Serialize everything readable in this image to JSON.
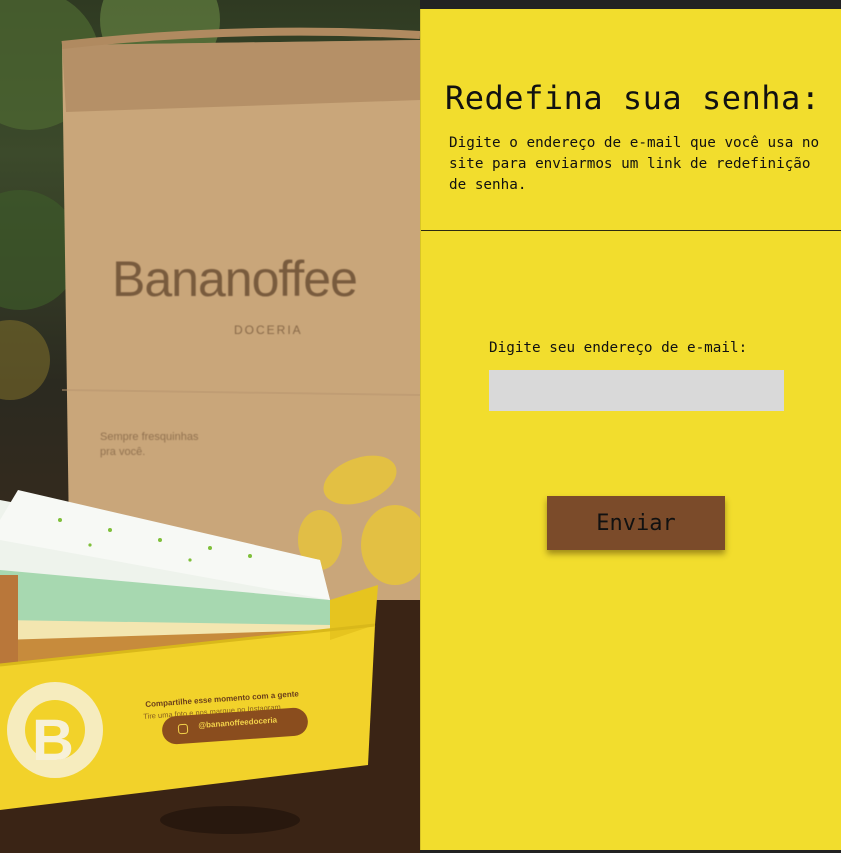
{
  "photo": {
    "bag_brand": "Bananoffee",
    "bag_sub": "DOCERIA",
    "bag_tagline": "Sempre fresquinhas pra você.",
    "box_share": "Compartilhe esse momento com a gente",
    "box_share2": "Tire uma foto e nos marque no Instagram",
    "box_handle": "@bananoffeedoceria"
  },
  "reset": {
    "title": "Redefina sua senha:",
    "description": "Digite o endereço de e-mail que você usa no site para enviarmos um link de redefinição de senha.",
    "email_label": "Digite seu endereço de e-mail:",
    "email_value": "",
    "send_label": "Enviar"
  },
  "colors": {
    "panel_bg": "#f2dd2d",
    "button_bg": "#7b4b2a",
    "input_bg": "#d9d9d9"
  }
}
